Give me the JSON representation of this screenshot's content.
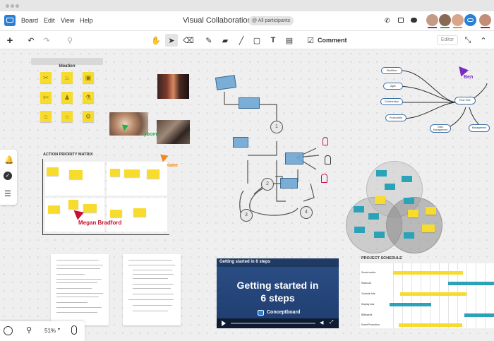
{
  "menubar": {
    "items": [
      "Board",
      "Edit",
      "View",
      "Help"
    ],
    "title": "Visual Collaboration",
    "participants_label": "@ All participants"
  },
  "toolbar": {
    "comment_label": "Comment",
    "editor_label": "Editor"
  },
  "canvas": {
    "ideation_label": "Ideation",
    "apm_label": "ACTION PRIORITY MATRIX",
    "project_schedule_label": "PROJECT SCHEDULE",
    "video_bar_label": "Getting started in 6 steps",
    "video_title": "Getting started in 6 steps",
    "video_brand": "Conceptboard",
    "cursors": {
      "ben": "Ben",
      "diane": "Diane",
      "megan": "Megan Bradford",
      "green": "...ybom"
    },
    "mindmap": {
      "center": "Real Time",
      "nodes": [
        "Workflow",
        "Agile",
        "Collaboration",
        "Productivity",
        "Team Management",
        "Management"
      ]
    },
    "schedule_rows": [
      "Social media",
      "Radio Ad",
      "Youtube Ads",
      "Display Ads",
      "Billboards",
      "Event Promotion"
    ],
    "flow_labels": [
      "1",
      "2",
      "3",
      "4"
    ]
  },
  "zoom": {
    "level": "51%"
  },
  "colors": {
    "accent": "#2a7fd4",
    "sticky": "#f7dc2e",
    "teal": "#2aa3b8",
    "ben": "#7a2ac2",
    "diane": "#f08a1e",
    "megan": "#c8102e",
    "green": "#1fb24a"
  }
}
